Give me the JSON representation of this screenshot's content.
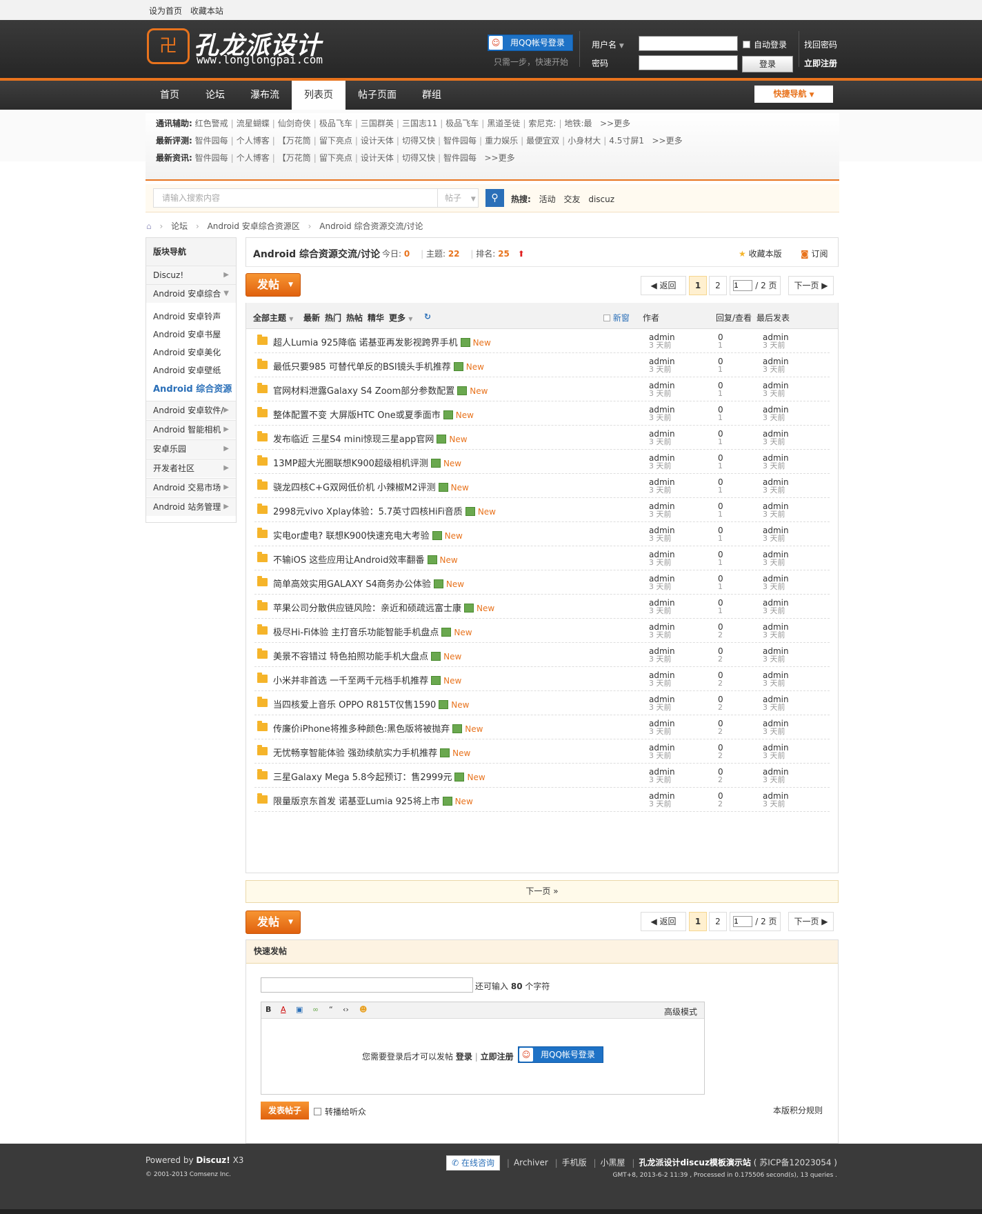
{
  "topbar": {
    "set_home": "设为首页",
    "favorite": "收藏本站"
  },
  "header": {
    "logo_text": "孔龙派设计",
    "logo_url": "www.longlongpai.com",
    "qq_login": "用QQ帐号登录",
    "qq_tip": "只需一步，快速开始",
    "username_label": "用户名",
    "password_label": "密码",
    "auto_login": "自动登录",
    "login_button": "登录",
    "find_password": "找回密码",
    "register": "立即注册"
  },
  "nav": {
    "items": [
      "首页",
      "论坛",
      "瀑布流",
      "列表页",
      "帖子页面",
      "群组"
    ],
    "active": "列表页",
    "quick_nav": "快捷导航"
  },
  "info": {
    "rows": [
      {
        "label": "通讯辅助:",
        "items": [
          "红色警戒",
          "流星蝴蝶",
          "仙剑奇侠",
          "极品飞车",
          "三国群英",
          "三国志11",
          "极品飞车",
          "黑道圣徒",
          "索尼克:",
          "地铁:最"
        ],
        "more": ">>更多"
      },
      {
        "label": "最新评测:",
        "items": [
          "智件园每",
          "个人博客",
          "【万花筒",
          "留下亮点",
          "设计天体",
          "切得又快",
          "智件园每",
          "重力娱乐",
          "最便宜双",
          "小身材大",
          "4.5寸屏1"
        ],
        "more": ">>更多"
      },
      {
        "label": "最新资讯:",
        "items": [
          "智件园每",
          "个人博客",
          "【万花筒",
          "留下亮点",
          "设计天体",
          "切得又快",
          "智件园每"
        ],
        "more": ">>更多"
      }
    ]
  },
  "search": {
    "placeholder": "请输入搜索内容",
    "type": "帖子",
    "hot_label": "热搜:",
    "hot": [
      "活动",
      "交友",
      "discuz"
    ]
  },
  "breadcrumb": [
    "论坛",
    "Android 安卓综合资源区",
    "Android 综合资源交流/讨论"
  ],
  "sidebar": {
    "title": "版块导航",
    "groups": [
      "Discuz!",
      "Android 安卓综合"
    ],
    "subs": [
      "Android 安卓铃声",
      "Android 安卓书屋",
      "Android 安卓美化",
      "Android 安卓壁纸",
      "Android 综合资源"
    ],
    "active_sub": "Android 综合资源",
    "more_groups": [
      "Android 安卓软件/",
      "Android 智能相机",
      "安卓乐园",
      "开发者社区",
      "Android 交易市场",
      "Android 站务管理"
    ]
  },
  "forum": {
    "title": "Android 综合资源交流/讨论",
    "today_label": "今日:",
    "today": "0",
    "threads_label": "主题:",
    "threads": "22",
    "rank_label": "排名:",
    "rank": "25",
    "favorite": "收藏本版",
    "subscribe": "订阅"
  },
  "toolbar": {
    "post": "发帖",
    "back": "返回",
    "page_current": "1",
    "page_two": "2",
    "page_input": "1",
    "page_total": "/ 2 页",
    "next": "下一页"
  },
  "thread_header": {
    "all": "全部主题",
    "latest": "最新",
    "hot": "热门",
    "hotpost": "热帖",
    "digest": "精华",
    "more": "更多",
    "new_window": "新窗",
    "author": "作者",
    "replies": "回复/查看",
    "last_post": "最后发表"
  },
  "threads": [
    {
      "title": "超人Lumia 925降临 诺基亚再发影视跨界手机",
      "author": "admin",
      "time": "3 天前",
      "replies": "0",
      "views": "1",
      "last": "admin",
      "last_time": "3 天前"
    },
    {
      "title": "最低只要985 可替代单反的BSI镜头手机推荐",
      "author": "admin",
      "time": "3 天前",
      "replies": "0",
      "views": "1",
      "last": "admin",
      "last_time": "3 天前"
    },
    {
      "title": "官网材料泄露Galaxy S4 Zoom部分参数配置",
      "author": "admin",
      "time": "3 天前",
      "replies": "0",
      "views": "1",
      "last": "admin",
      "last_time": "3 天前"
    },
    {
      "title": "整体配置不变 大屏版HTC One或夏季面市",
      "author": "admin",
      "time": "3 天前",
      "replies": "0",
      "views": "1",
      "last": "admin",
      "last_time": "3 天前"
    },
    {
      "title": "发布临近 三星S4 mini惊现三星app官网",
      "author": "admin",
      "time": "3 天前",
      "replies": "0",
      "views": "1",
      "last": "admin",
      "last_time": "3 天前"
    },
    {
      "title": "13MP超大光圈联想K900超级相机评测",
      "author": "admin",
      "time": "3 天前",
      "replies": "0",
      "views": "1",
      "last": "admin",
      "last_time": "3 天前"
    },
    {
      "title": "骁龙四核C+G双网低价机 小辣椒M2评测",
      "author": "admin",
      "time": "3 天前",
      "replies": "0",
      "views": "1",
      "last": "admin",
      "last_time": "3 天前"
    },
    {
      "title": "2998元vivo Xplay体验：5.7英寸四核HiFi音质",
      "author": "admin",
      "time": "3 天前",
      "replies": "0",
      "views": "1",
      "last": "admin",
      "last_time": "3 天前"
    },
    {
      "title": "实电or虚电? 联想K900快速充电大考验",
      "author": "admin",
      "time": "3 天前",
      "replies": "0",
      "views": "1",
      "last": "admin",
      "last_time": "3 天前"
    },
    {
      "title": "不输iOS 这些应用让Android效率翻番",
      "author": "admin",
      "time": "3 天前",
      "replies": "0",
      "views": "1",
      "last": "admin",
      "last_time": "3 天前"
    },
    {
      "title": "简单高效实用GALAXY S4商务办公体验",
      "author": "admin",
      "time": "3 天前",
      "replies": "0",
      "views": "1",
      "last": "admin",
      "last_time": "3 天前"
    },
    {
      "title": "苹果公司分散供应链风险：亲近和硕疏远富士康",
      "author": "admin",
      "time": "3 天前",
      "replies": "0",
      "views": "1",
      "last": "admin",
      "last_time": "3 天前"
    },
    {
      "title": "极尽Hi-Fi体验 主打音乐功能智能手机盘点",
      "author": "admin",
      "time": "3 天前",
      "replies": "0",
      "views": "2",
      "last": "admin",
      "last_time": "3 天前"
    },
    {
      "title": "美景不容错过 特色拍照功能手机大盘点",
      "author": "admin",
      "time": "3 天前",
      "replies": "0",
      "views": "2",
      "last": "admin",
      "last_time": "3 天前"
    },
    {
      "title": "小米并非首选 一千至两千元档手机推荐",
      "author": "admin",
      "time": "3 天前",
      "replies": "0",
      "views": "2",
      "last": "admin",
      "last_time": "3 天前"
    },
    {
      "title": "当四核爱上音乐 OPPO R815T仅售1590",
      "author": "admin",
      "time": "3 天前",
      "replies": "0",
      "views": "2",
      "last": "admin",
      "last_time": "3 天前"
    },
    {
      "title": "传廉价iPhone将推多种颜色:黑色版将被抛弃",
      "author": "admin",
      "time": "3 天前",
      "replies": "0",
      "views": "2",
      "last": "admin",
      "last_time": "3 天前"
    },
    {
      "title": "无忧畅享智能体验 强劲续航实力手机推荐",
      "author": "admin",
      "time": "3 天前",
      "replies": "0",
      "views": "2",
      "last": "admin",
      "last_time": "3 天前"
    },
    {
      "title": "三星Galaxy Mega 5.8今起预订：售2999元",
      "author": "admin",
      "time": "3 天前",
      "replies": "0",
      "views": "2",
      "last": "admin",
      "last_time": "3 天前"
    },
    {
      "title": "限量版京东首发 诺基亚Lumia 925将上市",
      "author": "admin",
      "time": "3 天前",
      "replies": "0",
      "views": "2",
      "last": "admin",
      "last_time": "3 天前"
    }
  ],
  "new_label": "New",
  "next_bar": "下一页 »",
  "quick_post": {
    "title": "快速发帖",
    "remain_prefix": "还可输入",
    "remain_count": "80",
    "remain_suffix": "个字符",
    "advanced": "高级模式",
    "login_msg": "您需要登录后才可以发帖",
    "login": "登录",
    "register": "立即注册",
    "qq_login": "用QQ帐号登录",
    "send": "发表帖子",
    "broadcast": "转播给听众",
    "rules": "本版积分规则"
  },
  "footer": {
    "powered_prefix": "Powered by",
    "powered_brand": "Discuz!",
    "powered_ver": "X3",
    "copyright": "© 2001-2013 Comsenz Inc.",
    "consult": "在线咨询",
    "links": [
      "Archiver",
      "手机版",
      "小黑屋"
    ],
    "site": "孔龙派设计discuz模板演示站",
    "icp": "( 苏ICP备12023054 )",
    "stats": "GMT+8, 2013-6-2 11:39 , Processed in 0.175506 second(s), 13 queries ."
  },
  "colors": {
    "accent": "#e8731d",
    "link_blue": "#2a6fb8",
    "header_bg": "#2e2e2e"
  }
}
